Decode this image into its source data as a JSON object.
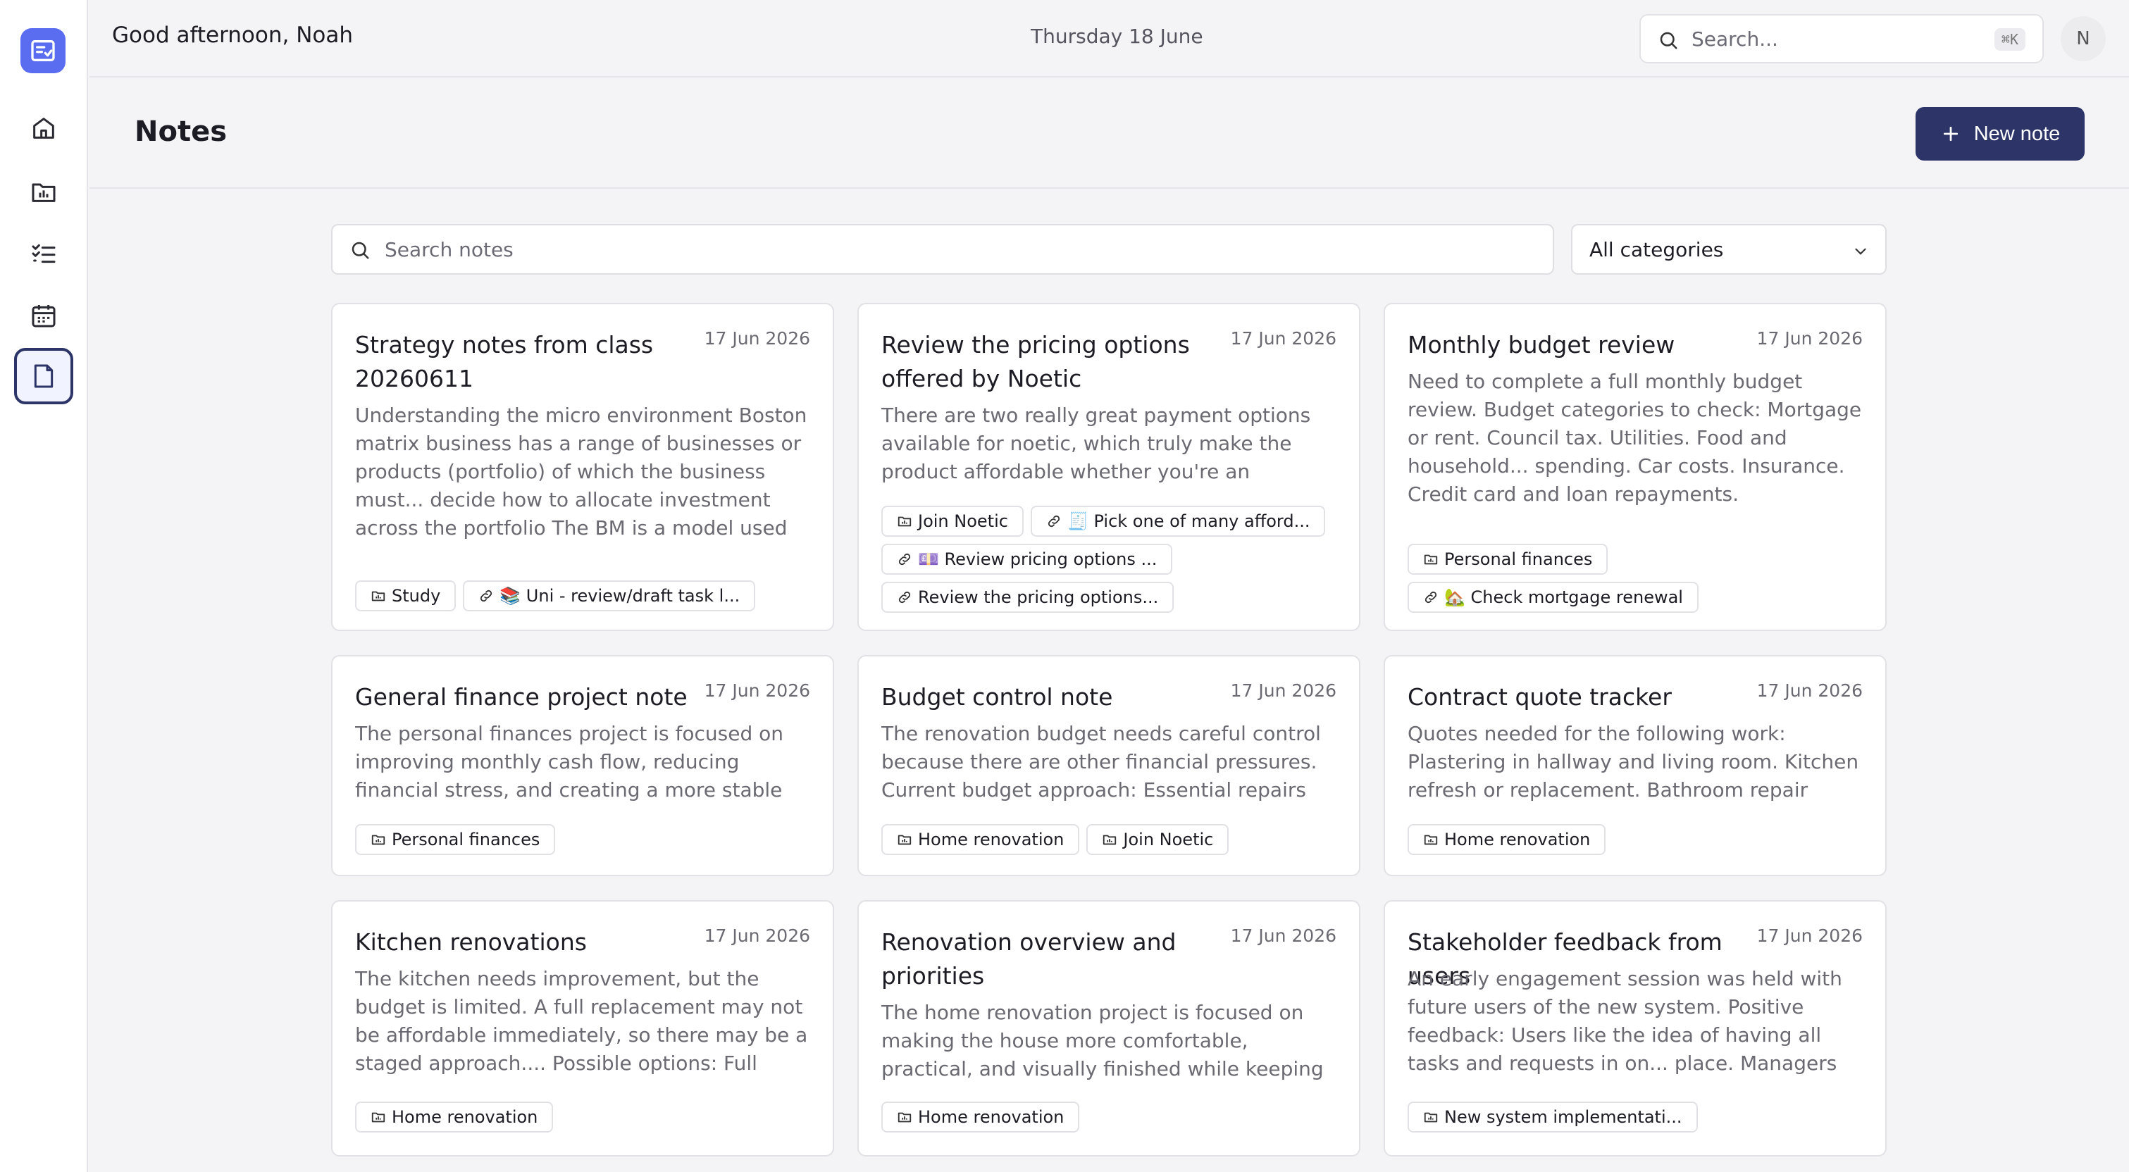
{
  "header": {
    "greeting": "Good afternoon, Noah",
    "date": "Thursday 18 June",
    "search_placeholder": "Search...",
    "shortcut": "⌘K",
    "avatar_initial": "N"
  },
  "sidebar": {
    "items": [
      {
        "name": "home",
        "icon": "home-icon"
      },
      {
        "name": "projects",
        "icon": "folder-chart-icon"
      },
      {
        "name": "tasks",
        "icon": "checklist-icon"
      },
      {
        "name": "calendar",
        "icon": "calendar-icon"
      },
      {
        "name": "notes",
        "icon": "note-icon",
        "active": true
      }
    ]
  },
  "page": {
    "title": "Notes",
    "new_note_label": "New note",
    "search_placeholder": "Search notes",
    "category_value": "All categories"
  },
  "colors": {
    "accent": "#2c3468",
    "logo": "#5a6cf0"
  },
  "notes": [
    {
      "title": "Strategy notes from class 20260611",
      "date": "17 Jun 2026",
      "body": "Understanding the micro environment  Boston matrix business has a range of businesses or products (portfolio) of which the business must... decide how to allocate investment across the portfolio The BM is a model used to analyse the portfolios It is a popular tool used in marketin",
      "tags": [
        {
          "type": "folder",
          "label": "Study"
        },
        {
          "type": "link",
          "label": "📚 Uni - review/draft task l..."
        }
      ]
    },
    {
      "title": "Review the pricing options offered by Noetic",
      "date": "17 Jun 2026",
      "body": "There are two really great payment options available for noetic, which truly make the product affordable whether you're an individual or a small...",
      "tags": [
        {
          "type": "folder",
          "label": "Join Noetic"
        },
        {
          "type": "link",
          "label": "🧾 Pick one of many afford..."
        },
        {
          "type": "link",
          "label": "💷 Review pricing options ..."
        },
        {
          "type": "link",
          "label": "Review the pricing options..."
        }
      ]
    },
    {
      "title": "Monthly budget review",
      "date": "17 Jun 2026",
      "body": "Need to complete a full monthly budget review. Budget categories to check: Mortgage or rent. Council tax. Utilities. Food and household... spending. Car costs. Insurance. Credit card and loan repayments. Subscriptions. Mobile and broadband. Renovation spending. Savings or emergenc",
      "tags": [
        {
          "type": "folder",
          "label": "Personal finances"
        },
        {
          "type": "link",
          "label": "🏡 Check mortgage renewal"
        }
      ]
    },
    {
      "title": "General finance project note",
      "date": "17 Jun 2026",
      "body": "The personal finances project is focused on improving monthly cash flow, reducing financial stress, and creating a more stable position over th...",
      "tags": [
        {
          "type": "folder",
          "label": "Personal finances"
        }
      ]
    },
    {
      "title": "Budget control note",
      "date": "17 Jun 2026",
      "body": "The renovation budget needs careful control because there are other financial pressures. Current budget approach: Essential repairs should be...",
      "tags": [
        {
          "type": "folder",
          "label": "Home renovation"
        },
        {
          "type": "folder",
          "label": "Join Noetic"
        }
      ]
    },
    {
      "title": "Contract quote tracker",
      "date": "17 Jun 2026",
      "body": "Quotes needed for the following work: Plastering in hallway and living room. Kitchen refresh or replacement. Bathroom repair work. Flooring in...",
      "tags": [
        {
          "type": "folder",
          "label": "Home renovation"
        }
      ]
    },
    {
      "title": "Kitchen renovations",
      "date": "17 Jun 2026",
      "body": "The kitchen needs improvement, but the budget is limited. A full replacement may not be affordable immediately, so there may be a staged approach.... Possible options: Full kitchen replacement Higher",
      "tags": [
        {
          "type": "folder",
          "label": "Home renovation"
        }
      ]
    },
    {
      "title": "Renovation overview and priorities",
      "date": "17 Jun 2026",
      "body": "The home renovation project is focused on making the house more comfortable, practical, and visually finished while keeping spending under control....",
      "tags": [
        {
          "type": "folder",
          "label": "Home renovation"
        }
      ]
    },
    {
      "title": "Stakeholder feedback from users",
      "date": "17 Jun 2026",
      "body": "An early engagement session was held with future users of the new system. Positive feedback: Users like the idea of having all tasks and requests in on... place. Managers want better reporting and fewer",
      "tags": [
        {
          "type": "folder",
          "label": "New system implementati..."
        }
      ]
    }
  ]
}
